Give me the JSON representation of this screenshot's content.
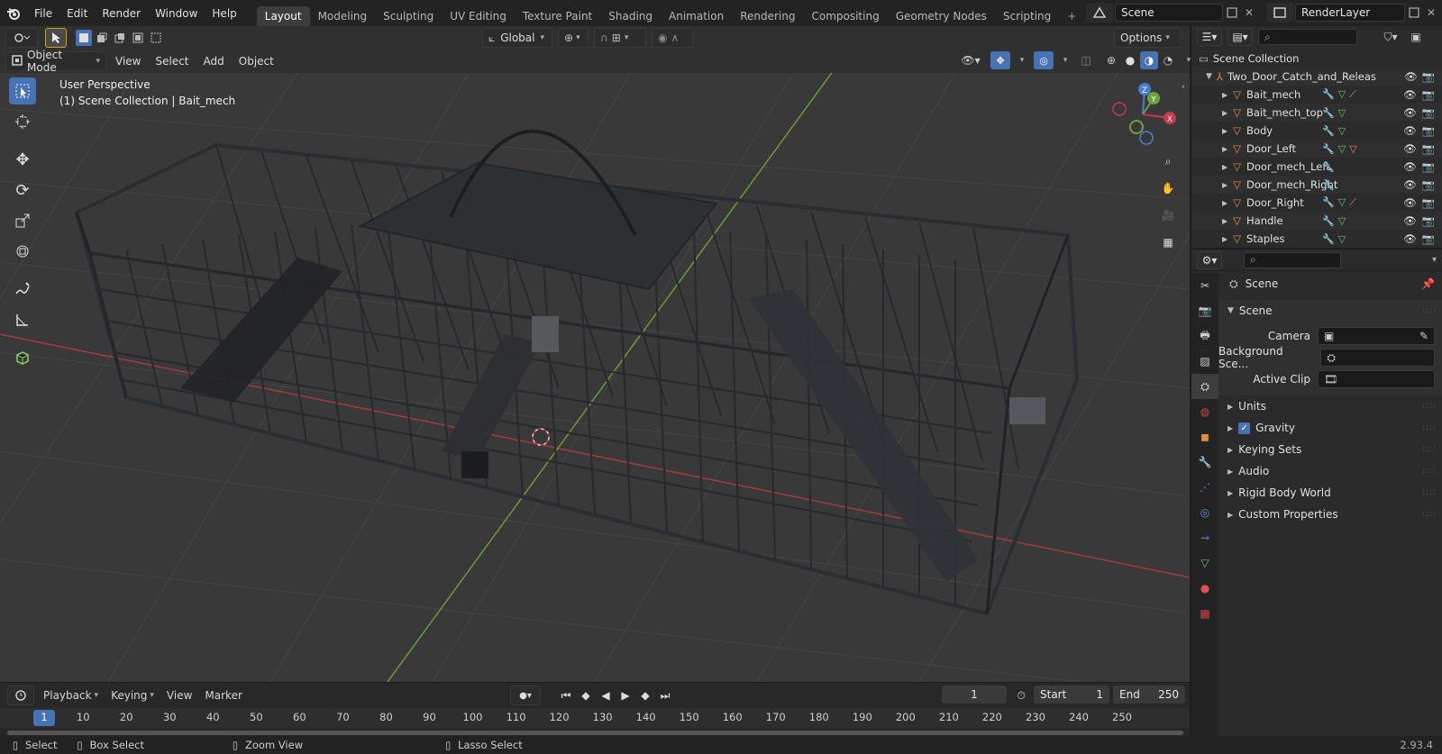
{
  "menu": [
    "File",
    "Edit",
    "Render",
    "Window",
    "Help"
  ],
  "workspaces": [
    "Layout",
    "Modeling",
    "Sculpting",
    "UV Editing",
    "Texture Paint",
    "Shading",
    "Animation",
    "Rendering",
    "Compositing",
    "Geometry Nodes",
    "Scripting"
  ],
  "active_workspace": "Layout",
  "scene_name": "Scene",
  "view_layer": "RenderLayer",
  "header": {
    "mode": "Object Mode",
    "menus": [
      "View",
      "Select",
      "Add",
      "Object"
    ],
    "transform_orientation": "Global",
    "options": "Options"
  },
  "viewport": {
    "title": "User Perspective",
    "subtitle": "(1) Scene Collection | Bait_mech",
    "axes": {
      "z": "Z",
      "y": "Y",
      "x": "X"
    }
  },
  "outliner": {
    "root": "Scene Collection",
    "collection": "Two_Door_Catch_and_Releas",
    "objects": [
      "Bait_mech",
      "Bait_mech_top",
      "Body",
      "Door_Left",
      "Door_mech_Left",
      "Door_mech_Right",
      "Door_Right",
      "Handle",
      "Staples"
    ]
  },
  "properties": {
    "context": "Scene",
    "panel": "Scene",
    "fields": {
      "camera": "Camera",
      "background": "Background Sce...",
      "active_clip": "Active Clip"
    },
    "sections": [
      "Units",
      "Gravity",
      "Keying Sets",
      "Audio",
      "Rigid Body World",
      "Custom Properties"
    ],
    "gravity_checked": true
  },
  "timeline": {
    "menus": [
      "Playback",
      "Keying",
      "View",
      "Marker"
    ],
    "current_frame": "1",
    "start_label": "Start",
    "start": "1",
    "end_label": "End",
    "end": "250",
    "ticks": [
      "1",
      "10",
      "20",
      "30",
      "40",
      "50",
      "60",
      "70",
      "80",
      "90",
      "100",
      "110",
      "120",
      "130",
      "140",
      "150",
      "160",
      "170",
      "180",
      "190",
      "200",
      "210",
      "220",
      "230",
      "240",
      "250"
    ]
  },
  "status": {
    "select": "Select",
    "box_select": "Box Select",
    "zoom_view": "Zoom View",
    "lasso_select": "Lasso Select",
    "version": "2.93.4"
  },
  "colors": {
    "accent": "#4772b3",
    "orange": "#e88d3a",
    "green_axis": "#6b9b34",
    "red_axis": "#a13c3c"
  }
}
